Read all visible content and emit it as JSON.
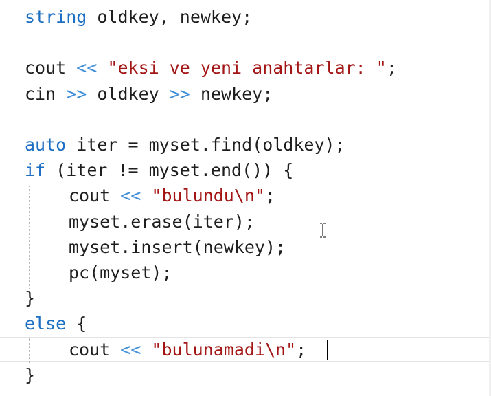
{
  "editor": {
    "lines": [
      {
        "tokens": [
          {
            "t": "string",
            "c": "kw"
          },
          {
            "t": " oldkey, newkey;",
            "c": "plain"
          }
        ]
      },
      {
        "tokens": []
      },
      {
        "tokens": [
          {
            "t": "cout ",
            "c": "plain"
          },
          {
            "t": "<<",
            "c": "op"
          },
          {
            "t": " ",
            "c": "plain"
          },
          {
            "t": "\"eksi ve yeni anahtarlar: \"",
            "c": "str"
          },
          {
            "t": ";",
            "c": "plain"
          }
        ]
      },
      {
        "tokens": [
          {
            "t": "cin ",
            "c": "plain"
          },
          {
            "t": ">>",
            "c": "op"
          },
          {
            "t": " oldkey ",
            "c": "plain"
          },
          {
            "t": ">>",
            "c": "op"
          },
          {
            "t": " newkey;",
            "c": "plain"
          }
        ]
      },
      {
        "tokens": []
      },
      {
        "tokens": [
          {
            "t": "auto",
            "c": "kw"
          },
          {
            "t": " iter = myset.find(oldkey);",
            "c": "plain"
          }
        ]
      },
      {
        "tokens": [
          {
            "t": "if",
            "c": "kw"
          },
          {
            "t": " (iter != myset.end()) {",
            "c": "plain"
          }
        ]
      },
      {
        "tokens": [
          {
            "t": "cout ",
            "c": "plain"
          },
          {
            "t": "<<",
            "c": "op"
          },
          {
            "t": " ",
            "c": "plain"
          },
          {
            "t": "\"bulundu\\n\"",
            "c": "str"
          },
          {
            "t": ";",
            "c": "plain"
          }
        ],
        "indent": true
      },
      {
        "tokens": [
          {
            "t": "myset.erase(iter);",
            "c": "plain"
          }
        ],
        "indent": true
      },
      {
        "tokens": [
          {
            "t": "myset.insert(newkey);",
            "c": "plain"
          }
        ],
        "indent": true
      },
      {
        "tokens": [
          {
            "t": "pc(myset);",
            "c": "plain"
          }
        ],
        "indent": true
      },
      {
        "tokens": [
          {
            "t": "}",
            "c": "plain"
          }
        ]
      },
      {
        "tokens": [
          {
            "t": "else",
            "c": "kw"
          },
          {
            "t": " {",
            "c": "plain"
          }
        ]
      },
      {
        "tokens": [
          {
            "t": "cout ",
            "c": "plain"
          },
          {
            "t": "<<",
            "c": "op"
          },
          {
            "t": " ",
            "c": "plain"
          },
          {
            "t": "\"bulunamadi\\n\"",
            "c": "str"
          },
          {
            "t": ";",
            "c": "plain"
          }
        ],
        "indent": true
      },
      {
        "tokens": [
          {
            "t": "}",
            "c": "plain"
          }
        ]
      }
    ]
  },
  "colors": {
    "keyword": "#1c6fc2",
    "operator": "#3f8ed8",
    "string": "#a31515",
    "text": "#1e1e1e",
    "background": "#ffffff"
  },
  "icons": {
    "mouse_cursor": "i-beam-cursor-icon",
    "text_caret": "text-caret"
  }
}
